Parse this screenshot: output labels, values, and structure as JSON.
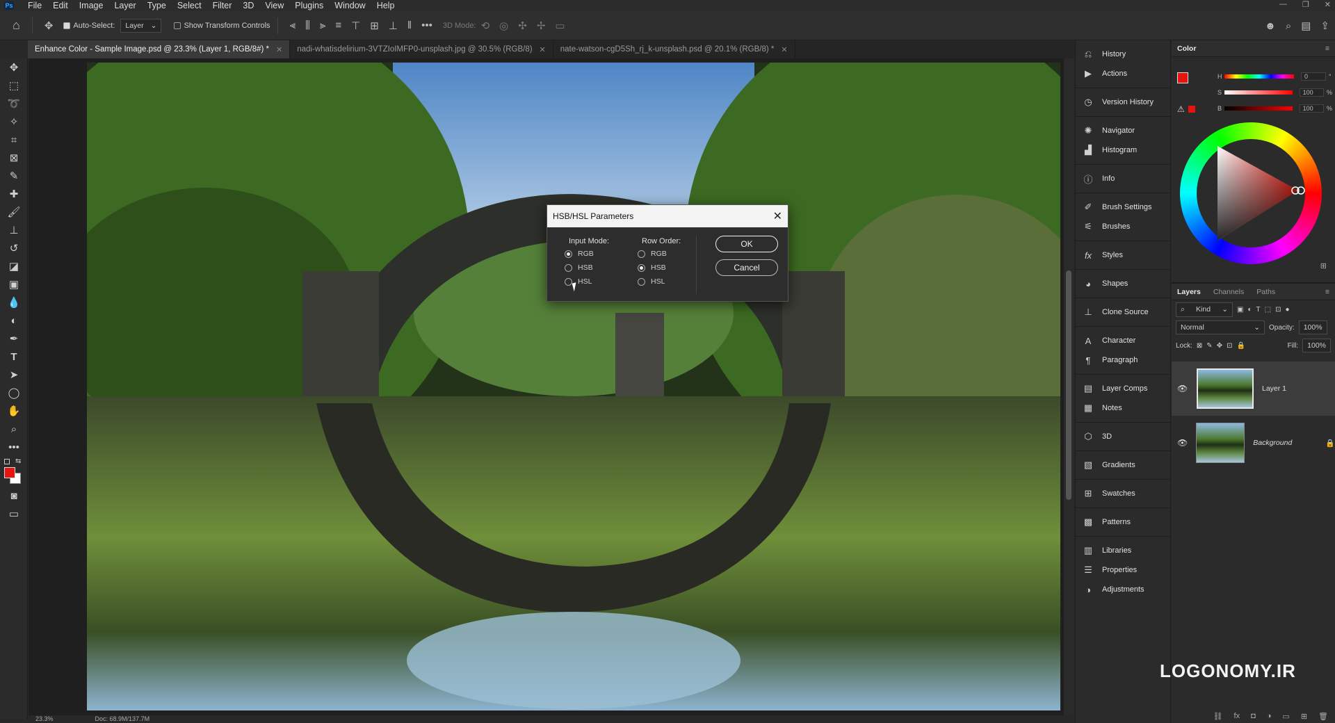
{
  "app": {
    "logo": "Ps"
  },
  "menu": [
    "File",
    "Edit",
    "Image",
    "Layer",
    "Type",
    "Select",
    "Filter",
    "3D",
    "View",
    "Plugins",
    "Window",
    "Help"
  ],
  "options": {
    "auto_select_label": "Auto-Select:",
    "auto_select_value": "Layer",
    "transform_label": "Show Transform Controls",
    "mode_3d_label": "3D Mode:"
  },
  "tabs": [
    {
      "label": "Enhance Color - Sample Image.psd @ 23.3% (Layer 1, RGB/8#) *"
    },
    {
      "label": "nadi-whatisdelirium-3VTZIoIMFP0-unsplash.jpg @ 30.5% (RGB/8)"
    },
    {
      "label": "nate-watson-cgD5Sh_rj_k-unsplash.psd @ 20.1% (RGB/8) *"
    }
  ],
  "status": {
    "zoom": "23.3%",
    "doc": "Doc: 68.9M/137.7M"
  },
  "dialog": {
    "title": "HSB/HSL Parameters",
    "input_mode_label": "Input Mode:",
    "row_order_label": "Row Order:",
    "input_options": [
      "RGB",
      "HSB",
      "HSL"
    ],
    "input_selected": "RGB",
    "row_options": [
      "RGB",
      "HSB",
      "HSL"
    ],
    "row_selected": "HSB",
    "ok_label": "OK",
    "cancel_label": "Cancel"
  },
  "mid_panels": {
    "g1": [
      "History",
      "Actions"
    ],
    "g2": [
      "Version History"
    ],
    "g3": [
      "Navigator",
      "Histogram"
    ],
    "g4": [
      "Info"
    ],
    "g5": [
      "Brush Settings",
      "Brushes"
    ],
    "g6": [
      "Styles"
    ],
    "g7": [
      "Shapes"
    ],
    "g8": [
      "Clone Source"
    ],
    "g9": [
      "Character",
      "Paragraph"
    ],
    "g10": [
      "Layer Comps",
      "Notes"
    ],
    "g11": [
      "3D"
    ],
    "g12": [
      "Gradients"
    ],
    "g13": [
      "Swatches"
    ],
    "g14": [
      "Patterns"
    ],
    "g15": [
      "Libraries",
      "Properties",
      "Adjustments"
    ]
  },
  "color_panel": {
    "title": "Color",
    "h_label": "H",
    "s_label": "S",
    "b_label": "B",
    "h_value": "0",
    "s_value": "100",
    "b_value": "100",
    "h_unit": "°",
    "s_unit": "%",
    "b_unit": "%",
    "fg_color": "#e8130e"
  },
  "layers_panel": {
    "tabs": [
      "Layers",
      "Channels",
      "Paths"
    ],
    "filter_label": "Kind",
    "blend_mode": "Normal",
    "opacity_label": "Opacity:",
    "opacity_value": "100%",
    "lock_label": "Lock:",
    "fill_label": "Fill:",
    "fill_value": "100%",
    "layers": [
      {
        "name": "Layer 1",
        "selected": true
      },
      {
        "name": "Background",
        "selected": false
      }
    ]
  },
  "watermark": "LOGONOMY.IR"
}
